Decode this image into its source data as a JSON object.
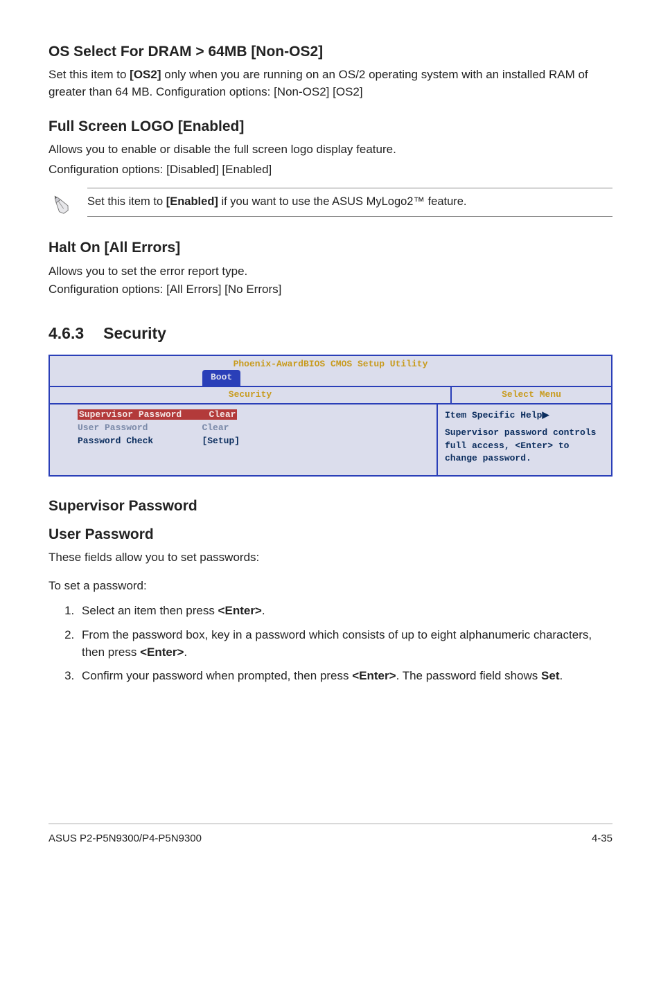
{
  "sections": {
    "os_select": {
      "title": "OS Select For DRAM > 64MB [Non-OS2]",
      "body": "Set this item to [OS2] only when you are running on an OS/2 operating system with an installed RAM of greater than 64 MB. Configuration options: [Non-OS2] [OS2]",
      "bold_inline": "[OS2]"
    },
    "full_screen": {
      "title": "Full Screen LOGO [Enabled]",
      "line1": "Allows you to enable or disable the full screen logo display feature.",
      "line2": "Configuration options: [Disabled] [Enabled]"
    },
    "note": {
      "pre": "Set this item to ",
      "bold": "[Enabled]",
      "post": " if you want to use the ASUS MyLogo2™ feature."
    },
    "halt": {
      "title": "Halt On [All Errors]",
      "line1": "Allows you to set the error report type.",
      "line2": "Configuration options: [All Errors] [No Errors]"
    }
  },
  "chapter": {
    "num": "4.6.3",
    "title": "Security"
  },
  "bios": {
    "title_bar": "Phoenix-AwardBIOS CMOS Setup Utility",
    "tab": "Boot",
    "left_header": "Security",
    "right_header": "Select Menu",
    "items": [
      {
        "label": "Supervisor Password",
        "value": "Clear",
        "highlight": true
      },
      {
        "label": "User Password",
        "value": "Clear",
        "highlight": false
      },
      {
        "label": "Password Check",
        "value": "[Setup]",
        "highlight": false
      }
    ],
    "help": {
      "title": "Item Specific Help",
      "body": "Supervisor password controls full access, <Enter> to change password."
    }
  },
  "pw_section": {
    "sup_title": "Supervisor Password",
    "user_title": "User Password",
    "intro": "These fields allow you to set passwords:",
    "to_set": "To set a password:",
    "steps": {
      "s1_pre": "Select an item then press ",
      "s1_b": "<Enter>",
      "s1_post": ".",
      "s2_pre": "From the password box, key in a password which consists of up to eight alphanumeric characters, then press ",
      "s2_b": "<Enter>",
      "s2_post": ".",
      "s3_pre": "Confirm your password when prompted, then press ",
      "s3_b": "<Enter>",
      "s3_mid": ". The password field shows ",
      "s3_b2": "Set",
      "s3_post": "."
    }
  },
  "footer": {
    "left": "ASUS P2-P5N9300/P4-P5N9300",
    "right": "4-35"
  }
}
